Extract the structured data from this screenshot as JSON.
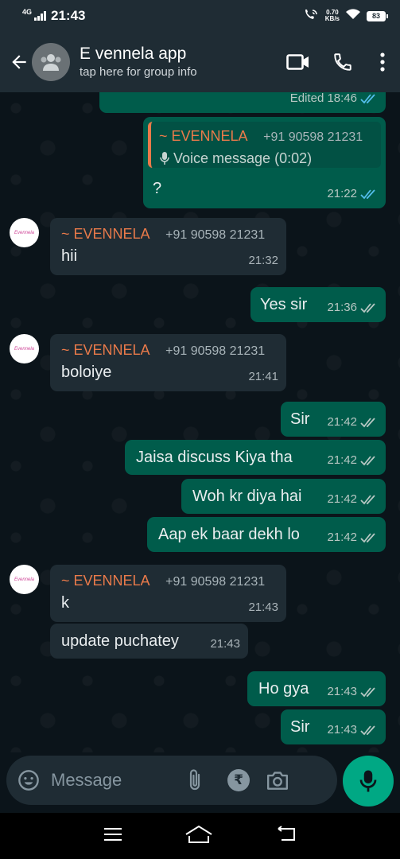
{
  "status_bar": {
    "network": "4G",
    "time": "21:43",
    "speed_value": "0.70",
    "speed_unit": "KB/s",
    "battery": "83"
  },
  "header": {
    "title": "E vennela app",
    "subtitle": "tap here for group info"
  },
  "messages": [
    {
      "id": "m0",
      "direction": "out",
      "text": "",
      "time": "Edited 18:46",
      "status": "read"
    },
    {
      "id": "m1",
      "direction": "out",
      "reply_sender": "~ EVENNELA",
      "reply_phone": "+91 90598 21231",
      "reply_text": "Voice message (0:02)",
      "text": "?",
      "time": "21:22",
      "status": "read"
    },
    {
      "id": "m2",
      "direction": "in",
      "sender": "~ EVENNELA",
      "phone": "+91 90598 21231",
      "text": "hii",
      "time": "21:32"
    },
    {
      "id": "m3",
      "direction": "out",
      "text": "Yes sir",
      "time": "21:36",
      "status": "delivered"
    },
    {
      "id": "m4",
      "direction": "in",
      "sender": "~ EVENNELA",
      "phone": "+91 90598 21231",
      "text": "boloiye",
      "time": "21:41"
    },
    {
      "id": "m5",
      "direction": "out",
      "text": "Sir",
      "time": "21:42",
      "status": "delivered"
    },
    {
      "id": "m6",
      "direction": "out",
      "text": "Jaisa discuss Kiya tha",
      "time": "21:42",
      "status": "delivered"
    },
    {
      "id": "m7",
      "direction": "out",
      "text": "Woh kr diya hai",
      "time": "21:42",
      "status": "delivered"
    },
    {
      "id": "m8",
      "direction": "out",
      "text": "Aap ek baar dekh lo",
      "time": "21:42",
      "status": "delivered"
    },
    {
      "id": "m9",
      "direction": "in",
      "sender": "~ EVENNELA",
      "phone": "+91 90598 21231",
      "text": "k",
      "time": "21:43"
    },
    {
      "id": "m10",
      "direction": "in",
      "text": "update puchatey",
      "time": "21:43"
    },
    {
      "id": "m11",
      "direction": "out",
      "text": "Ho gya",
      "time": "21:43",
      "status": "delivered"
    },
    {
      "id": "m12",
      "direction": "out",
      "text": "Sir",
      "time": "21:43",
      "status": "delivered"
    }
  ],
  "avatar_label": "Evennela",
  "composer": {
    "placeholder": "Message",
    "rupee_symbol": "₹"
  },
  "colors": {
    "header_bg": "#1f2c34",
    "chat_bg": "#0b141a",
    "outgoing_bubble": "#005c4b",
    "incoming_bubble": "#1f2c34",
    "sender_name": "#e97a4a",
    "read_tick": "#53bdeb",
    "accent_green": "#00a884"
  }
}
